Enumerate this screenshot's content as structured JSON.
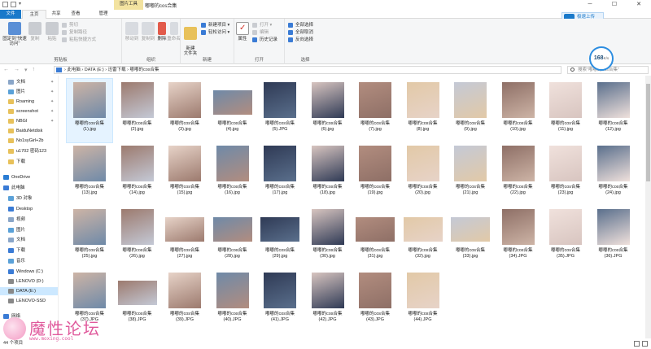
{
  "title_bar": {
    "context_tab": "图片工具",
    "window_title": "嘟嘟的cos合集",
    "minimize": "─",
    "maximize": "☐",
    "close": "✕"
  },
  "ribbon_tabs": {
    "file": "文件",
    "home": "主页",
    "share": "共享",
    "view": "查看",
    "manage": "管理"
  },
  "baidu_upload": "极速上传",
  "ribbon": {
    "pin_quick": "固定到\"快速访问\"",
    "copy": "复制",
    "paste": "粘贴",
    "cut": "剪切",
    "copy_path": "复制路径",
    "paste_shortcut": "粘贴快捷方式",
    "clipboard_group": "剪贴板",
    "move_to": "移动到",
    "copy_to": "复制到",
    "delete": "删除",
    "rename": "重命名",
    "organize_group": "组织",
    "new_folder": "新建\n文件夹",
    "new_item": "新建项目 ▾",
    "easy_access": "轻松访问 ▾",
    "new_group": "新建",
    "properties": "属性",
    "open": "打开 ▾",
    "edit": "编辑",
    "history": "历史记录",
    "open_group": "打开",
    "select_all": "全部选择",
    "select_none": "全部取消",
    "invert": "反向选择",
    "select_group": "选择"
  },
  "address": {
    "path": "›  此电脑  ›  DATA (E:)  ›  迅雷下载  ›  嘟嘟的cos合集",
    "search_placeholder": "搜索\"嘟嘟的cos合集\""
  },
  "badge": {
    "value": "168",
    "unit": "K/s"
  },
  "nav_pane": [
    {
      "label": "文档",
      "pinned": true,
      "color": "#8aa6c8"
    },
    {
      "label": "图片",
      "pinned": true,
      "color": "#5aa1d8"
    },
    {
      "label": "Roaming",
      "pinned": true,
      "color": "#e8c15a"
    },
    {
      "label": "screenshot",
      "pinned": true,
      "color": "#e8c15a"
    },
    {
      "label": "NBGI",
      "pinned": true,
      "color": "#e8c15a"
    },
    {
      "label": "BaiduNetdisk",
      "pinned": false,
      "color": "#e8c15a"
    },
    {
      "label": "No1syGirl+2b",
      "pinned": false,
      "color": "#e8c15a"
    },
    {
      "label": "u1702 密码123",
      "pinned": false,
      "color": "#e8c15a"
    },
    {
      "label": "下载",
      "pinned": false,
      "color": "#e8c15a"
    },
    {
      "label": "OneDrive",
      "pinned": false,
      "color": "#2b7cd3"
    },
    {
      "label": "此电脑",
      "pinned": false,
      "color": "#3a7bd5"
    },
    {
      "label": "3D 对象",
      "pinned": false,
      "color": "#5aa1d8"
    },
    {
      "label": "Desktop",
      "pinned": false,
      "color": "#3a7bd5"
    },
    {
      "label": "视频",
      "pinned": false,
      "color": "#8aa6c8"
    },
    {
      "label": "图片",
      "pinned": false,
      "color": "#5aa1d8"
    },
    {
      "label": "文档",
      "pinned": false,
      "color": "#8aa6c8"
    },
    {
      "label": "下载",
      "pinned": false,
      "color": "#3a7bd5"
    },
    {
      "label": "音乐",
      "pinned": false,
      "color": "#5aa1d8"
    },
    {
      "label": "Windows (C:)",
      "pinned": false,
      "color": "#3a7bd5"
    },
    {
      "label": "LENOVO (D:)",
      "pinned": false,
      "color": "#888888"
    },
    {
      "label": "DATA (E:)",
      "pinned": false,
      "color": "#888888"
    },
    {
      "label": "LENOVO-SSD",
      "pinned": false,
      "color": "#888888"
    },
    {
      "label": "网络",
      "pinned": false,
      "color": "#3a7bd5"
    }
  ],
  "files": [
    {
      "name": "嘟嘟的cos合集",
      "ext": "(1).jpg"
    },
    {
      "name": "嘟嘟的cos合集",
      "ext": "(2).jpg"
    },
    {
      "name": "嘟嘟的cos合集",
      "ext": "(3).jpg"
    },
    {
      "name": "嘟嘟的cos合集",
      "ext": "(4).jpg"
    },
    {
      "name": "嘟嘟的cos合集",
      "ext": "(5).JPG"
    },
    {
      "name": "嘟嘟的cos合集",
      "ext": "(6).jpg"
    },
    {
      "name": "嘟嘟的cos合集",
      "ext": "(7).jpg"
    },
    {
      "name": "嘟嘟的cos合集",
      "ext": "(8).jpg"
    },
    {
      "name": "嘟嘟的cos合集",
      "ext": "(9).jpg"
    },
    {
      "name": "嘟嘟的cos合集",
      "ext": "(10).jpg"
    },
    {
      "name": "嘟嘟的cos合集",
      "ext": "(11).jpg"
    },
    {
      "name": "嘟嘟的cos合集",
      "ext": "(12).jpg"
    },
    {
      "name": "嘟嘟的cos合集",
      "ext": "(13).jpg"
    },
    {
      "name": "嘟嘟的cos合集",
      "ext": "(14).jpg"
    },
    {
      "name": "嘟嘟的cos合集",
      "ext": "(15).jpg"
    },
    {
      "name": "嘟嘟的cos合集",
      "ext": "(16).jpg"
    },
    {
      "name": "嘟嘟的cos合集",
      "ext": "(17).jpg"
    },
    {
      "name": "嘟嘟的cos合集",
      "ext": "(18).jpg"
    },
    {
      "name": "嘟嘟的cos合集",
      "ext": "(19).jpg"
    },
    {
      "name": "嘟嘟的cos合集",
      "ext": "(20).jpg"
    },
    {
      "name": "嘟嘟的cos合集",
      "ext": "(21).jpg"
    },
    {
      "name": "嘟嘟的cos合集",
      "ext": "(22).jpg"
    },
    {
      "name": "嘟嘟的cos合集",
      "ext": "(23).jpg"
    },
    {
      "name": "嘟嘟的cos合集",
      "ext": "(24).jpg"
    },
    {
      "name": "嘟嘟的cos合集",
      "ext": "(25).jpg"
    },
    {
      "name": "嘟嘟的cos合集",
      "ext": "(26).jpg"
    },
    {
      "name": "嘟嘟的cos合集",
      "ext": "(27).jpg"
    },
    {
      "name": "嘟嘟的cos合集",
      "ext": "(28).jpg"
    },
    {
      "name": "嘟嘟的cos合集",
      "ext": "(29).jpg"
    },
    {
      "name": "嘟嘟的cos合集",
      "ext": "(30).jpg"
    },
    {
      "name": "嘟嘟的cos合集",
      "ext": "(31).jpg"
    },
    {
      "name": "嘟嘟的cos合集",
      "ext": "(32).jpg"
    },
    {
      "name": "嘟嘟的cos合集",
      "ext": "(33).jpg"
    },
    {
      "name": "嘟嘟的cos合集",
      "ext": "(34).JPG"
    },
    {
      "name": "嘟嘟的cos合集",
      "ext": "(35).JPG"
    },
    {
      "name": "嘟嘟的cos合集",
      "ext": "(36).JPG"
    },
    {
      "name": "嘟嘟的cos合集",
      "ext": "(37).JPG"
    },
    {
      "name": "嘟嘟的cos合集",
      "ext": "(38).JPG"
    },
    {
      "name": "嘟嘟的cos合集",
      "ext": "(39).JPG"
    },
    {
      "name": "嘟嘟的cos合集",
      "ext": "(40).JPG"
    },
    {
      "name": "嘟嘟的cos合集",
      "ext": "(41).JPG"
    },
    {
      "name": "嘟嘟的cos合集",
      "ext": "(42).JPG"
    },
    {
      "name": "嘟嘟的cos合集",
      "ext": "(43).JPG"
    },
    {
      "name": "嘟嘟的cos合集",
      "ext": "(44).JPG"
    }
  ],
  "status": {
    "count": "44 个项目"
  },
  "watermark": {
    "title": "魔性论坛",
    "url": "www.moxing.cool"
  }
}
